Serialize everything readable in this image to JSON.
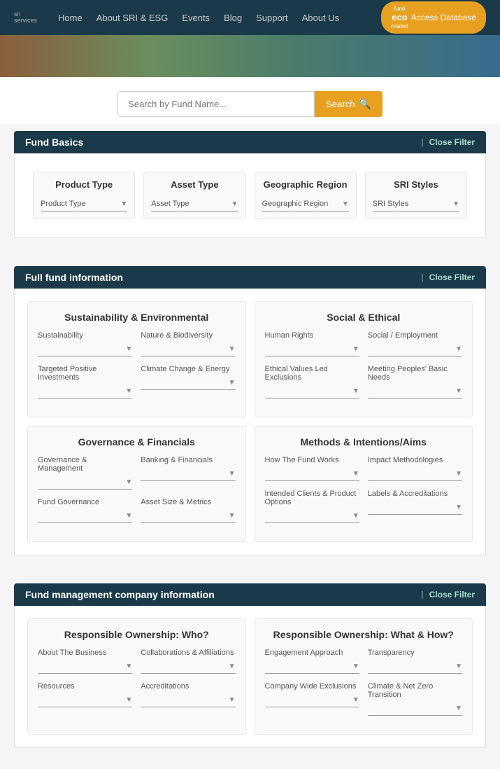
{
  "nav": {
    "logo_line1": "sri",
    "logo_line2": "services",
    "links": [
      "Home",
      "About SRI & ESG",
      "Events",
      "Blog",
      "Support",
      "About Us"
    ],
    "eco_label": "fund",
    "eco_sub": "eco",
    "eco_market": "market",
    "eco_btn_text": "Access Database"
  },
  "search": {
    "placeholder": "Search by Fund Name...",
    "btn_label": "Search"
  },
  "fund_basics": {
    "header": "Fund Basics",
    "close_filter": "Close Filter",
    "items": [
      {
        "title": "Product Type",
        "dropdown": "Product Type"
      },
      {
        "title": "Asset Type",
        "dropdown": "Asset Type"
      },
      {
        "title": "Geographic Region",
        "dropdown": "Geographic Region"
      },
      {
        "title": "SRI Styles",
        "dropdown": "SRI Styles"
      }
    ]
  },
  "full_fund": {
    "header": "Full fund information",
    "close_filter": "Close Filter",
    "groups": [
      {
        "title": "Sustainability & Environmental",
        "rows": [
          [
            {
              "label": "Sustainability",
              "value": ""
            },
            {
              "label": "Nature & Biodiversity",
              "value": ""
            }
          ],
          [
            {
              "label": "Targeted Positive Investments",
              "value": ""
            },
            {
              "label": "Climate Change & Energy",
              "value": ""
            }
          ]
        ]
      },
      {
        "title": "Social & Ethical",
        "rows": [
          [
            {
              "label": "Human Rights",
              "value": ""
            },
            {
              "label": "Social / Employment",
              "value": ""
            }
          ],
          [
            {
              "label": "Ethical Values Led Exclusions",
              "value": ""
            },
            {
              "label": "Meeting Peoples' Basic Needs",
              "value": ""
            }
          ]
        ]
      },
      {
        "title": "Governance & Financials",
        "rows": [
          [
            {
              "label": "Governance & Management",
              "value": ""
            },
            {
              "label": "Banking & Financials",
              "value": ""
            }
          ],
          [
            {
              "label": "Fund Governance",
              "value": ""
            },
            {
              "label": "Asset Size & Metrics",
              "value": ""
            }
          ]
        ]
      },
      {
        "title": "Methods & Intentions/Aims",
        "rows": [
          [
            {
              "label": "How The Fund Works",
              "value": ""
            },
            {
              "label": "Impact Methodologies",
              "value": ""
            }
          ],
          [
            {
              "label": "Intended Clients & Product Options",
              "value": ""
            },
            {
              "label": "Labels & Accreditations",
              "value": ""
            }
          ]
        ]
      }
    ]
  },
  "fund_management": {
    "header": "Fund management company information",
    "close_filter": "Close Filter",
    "groups": [
      {
        "title": "Responsible Ownership: Who?",
        "rows": [
          [
            {
              "label": "About The Business",
              "value": ""
            },
            {
              "label": "Collaborations & Affiliations",
              "value": ""
            }
          ],
          [
            {
              "label": "Resources",
              "value": ""
            },
            {
              "label": "Accreditations",
              "value": ""
            }
          ]
        ]
      },
      {
        "title": "Responsible Ownership: What & How?",
        "rows": [
          [
            {
              "label": "Engagement Approach",
              "value": ""
            },
            {
              "label": "Transparency",
              "value": ""
            }
          ],
          [
            {
              "label": "Company Wide Exclusions",
              "value": ""
            },
            {
              "label": "Climate & Net Zero Transition",
              "value": ""
            }
          ]
        ]
      }
    ]
  }
}
